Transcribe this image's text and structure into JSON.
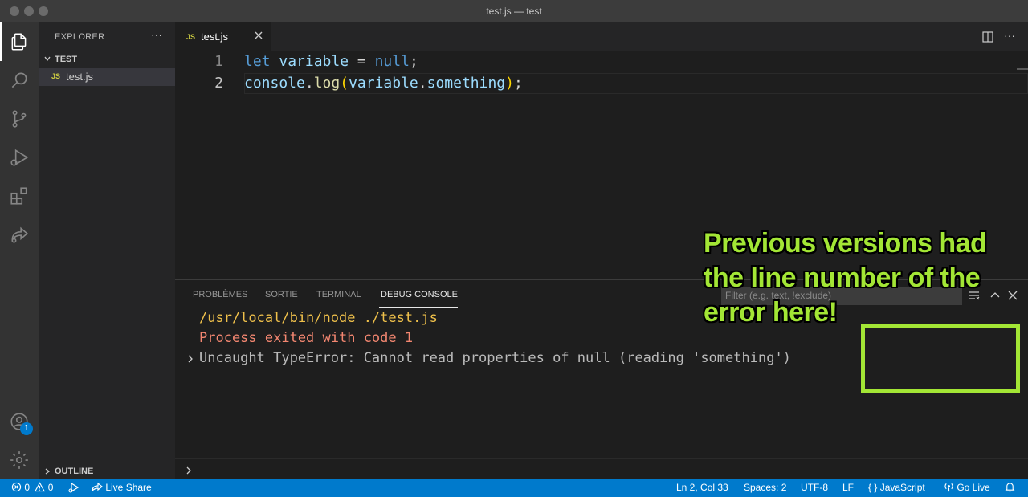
{
  "window": {
    "title": "test.js — test"
  },
  "colors": {
    "accent": "#007acc",
    "annotation": "#a3e635",
    "error_text": "#f48771",
    "command_text": "#f0c14b"
  },
  "activity_bar": {
    "items": [
      "files-icon",
      "search-icon",
      "source-control-icon",
      "run-debug-icon",
      "extensions-icon",
      "live-share-icon"
    ],
    "bottom": [
      "account-icon",
      "settings-gear-icon"
    ],
    "account_badge": "1"
  },
  "sidebar": {
    "title": "EXPLORER",
    "more": "···",
    "folder": "TEST",
    "files": [
      {
        "icon_text": "JS",
        "name": "test.js"
      }
    ],
    "outline": "OUTLINE"
  },
  "editor": {
    "tab": {
      "icon_text": "JS",
      "name": "test.js"
    },
    "more": "···",
    "lines": [
      {
        "n": "1",
        "tokens": [
          {
            "t": "let",
            "c": "kw"
          },
          {
            "t": " ",
            "c": ""
          },
          {
            "t": "variable",
            "c": "var"
          },
          {
            "t": " = ",
            "c": ""
          },
          {
            "t": "null",
            "c": "kw"
          },
          {
            "t": ";",
            "c": ""
          }
        ]
      },
      {
        "n": "2",
        "tokens": [
          {
            "t": "console",
            "c": "var"
          },
          {
            "t": ".",
            "c": ""
          },
          {
            "t": "log",
            "c": "fn"
          },
          {
            "t": "(",
            "c": "pn"
          },
          {
            "t": "variable",
            "c": "var"
          },
          {
            "t": ".",
            "c": ""
          },
          {
            "t": "something",
            "c": "var"
          },
          {
            "t": ")",
            "c": "pn"
          },
          {
            "t": ";",
            "c": ""
          }
        ]
      }
    ],
    "line1_num": "1",
    "line2_num": "2"
  },
  "panel": {
    "tabs": {
      "problems": "PROBLÈMES",
      "output": "SORTIE",
      "terminal": "TERMINAL",
      "debug": "DEBUG CONSOLE"
    },
    "filter_placeholder": "Filter (e.g. text, !exclude)",
    "output": {
      "line1": "/usr/local/bin/node ./test.js",
      "line2": "Process exited with code 1",
      "line3": "Uncaught TypeError: Cannot read properties of null (reading 'something')"
    }
  },
  "annotation": {
    "line1": "Previous versions had",
    "line2": "the line number of the",
    "line3": "error here!"
  },
  "status_bar": {
    "errors": "0",
    "warnings": "0",
    "live_share": "Live Share",
    "position": "Ln 2, Col 33",
    "spaces": "Spaces: 2",
    "encoding": "UTF-8",
    "eol": "LF",
    "language": "JavaScript",
    "go_live": "Go Live"
  }
}
